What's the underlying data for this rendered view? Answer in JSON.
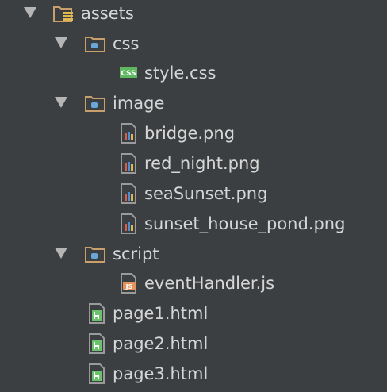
{
  "tree": {
    "root": {
      "label": "assets",
      "icon": "resource-folder-icon",
      "expanded": true
    },
    "folders": [
      {
        "label": "css",
        "icon": "folder-icon",
        "expanded": true
      },
      {
        "label": "image",
        "icon": "folder-icon",
        "expanded": true
      },
      {
        "label": "script",
        "icon": "folder-icon",
        "expanded": true
      }
    ],
    "files": {
      "css": [
        {
          "label": "style.css",
          "icon": "css-file-icon"
        }
      ],
      "image": [
        {
          "label": "bridge.png",
          "icon": "image-file-icon"
        },
        {
          "label": "red_night.png",
          "icon": "image-file-icon"
        },
        {
          "label": "seaSunset.png",
          "icon": "image-file-icon"
        },
        {
          "label": "sunset_house_pond.png",
          "icon": "image-file-icon"
        }
      ],
      "script": [
        {
          "label": "eventHandler.js",
          "icon": "js-file-icon"
        }
      ],
      "root": [
        {
          "label": "page1.html",
          "icon": "html-file-icon"
        },
        {
          "label": "page2.html",
          "icon": "html-file-icon"
        },
        {
          "label": "page3.html",
          "icon": "html-file-icon"
        }
      ]
    },
    "colors": {
      "background": "#3c3f41",
      "text": "#d6d6d6",
      "folder": "#c9a06b",
      "folder_dot": "#6aa6d8",
      "html_icon": "#6cc16c",
      "css_icon": "#5fb85f",
      "js_icon": "#e3935b",
      "arrow": "#b5b5b5"
    }
  }
}
